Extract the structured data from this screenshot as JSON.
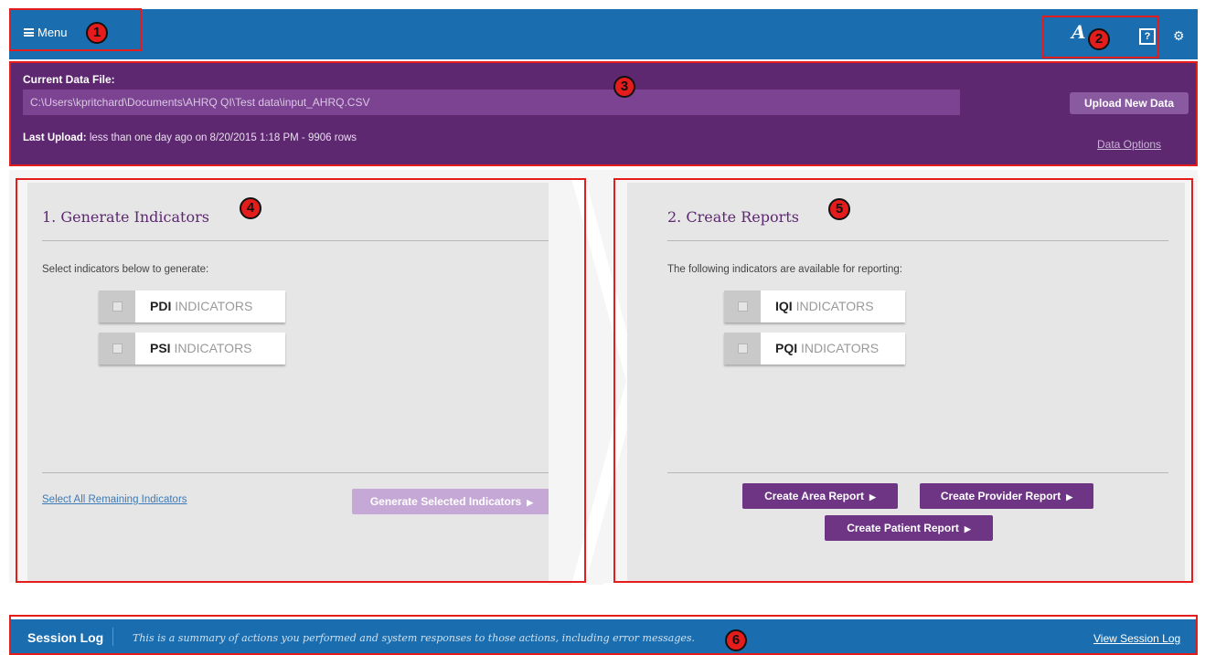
{
  "topbar": {
    "menu_label": "Menu",
    "logo_text": "A",
    "help_label": "?",
    "settings_icon": "gear-icon"
  },
  "data_file": {
    "label": "Current Data File:",
    "path": "C:\\Users\\kpritchard\\Documents\\AHRQ QI\\Test data\\input_AHRQ.CSV",
    "upload_button": "Upload New Data",
    "last_upload_label": "Last Upload:",
    "last_upload_text": "less than one day ago on 8/20/2015 1:18 PM - 9906 rows",
    "data_options_link": "Data Options"
  },
  "generate": {
    "title": "1. Generate Indicators",
    "subtitle": "Select indicators below to generate:",
    "indicators": [
      {
        "code": "PDI",
        "word": "INDICATORS"
      },
      {
        "code": "PSI",
        "word": "INDICATORS"
      }
    ],
    "select_all_link": "Select All Remaining Indicators",
    "generate_button": "Generate Selected Indicators"
  },
  "reports": {
    "title": "2. Create Reports",
    "subtitle": "The following indicators are available for reporting:",
    "indicators": [
      {
        "code": "IQI",
        "word": "INDICATORS"
      },
      {
        "code": "PQI",
        "word": "INDICATORS"
      }
    ],
    "area_button": "Create Area Report",
    "provider_button": "Create Provider Report",
    "patient_button": "Create Patient Report"
  },
  "session_log": {
    "title": "Session Log",
    "description": "This is a summary of actions you performed and system responses to those actions, including error messages.",
    "view_link": "View Session Log"
  },
  "callouts": [
    "1",
    "2",
    "3",
    "4",
    "5",
    "6"
  ],
  "colors": {
    "topbar": "#1a6eb0",
    "data_band": "#5e2870",
    "report_button": "#6e3585",
    "generate_button_disabled": "#c5a8d6",
    "annotation": "#e41c1c"
  }
}
